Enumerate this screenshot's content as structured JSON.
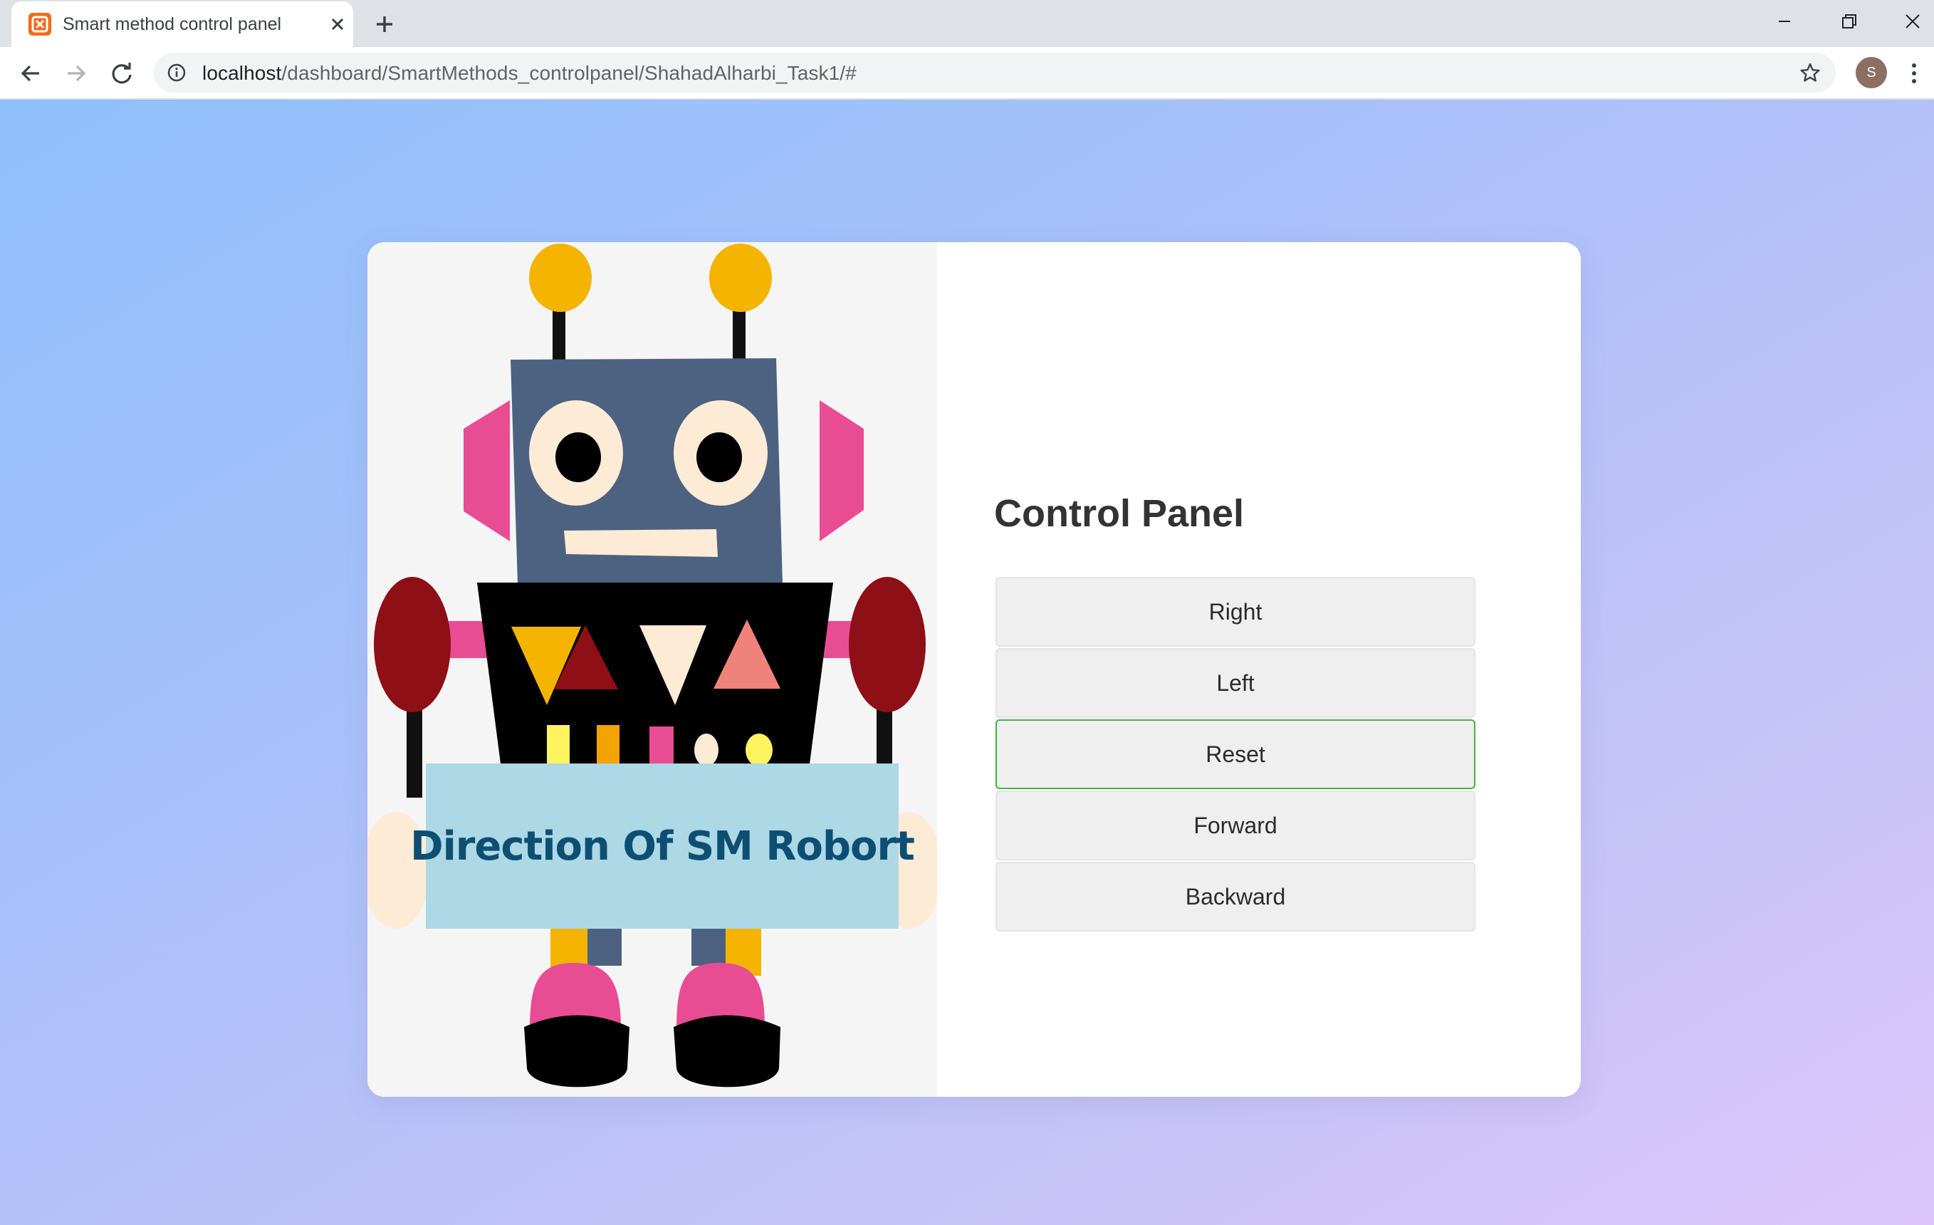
{
  "browser": {
    "tab_title": "Smart method control panel",
    "url_host": "localhost",
    "url_path": "/dashboard/SmartMethods_controlpanel/ShahadAlharbi_Task1/#",
    "profile_initial": "S"
  },
  "robot": {
    "sign_text": "Direction Of SM Robort"
  },
  "control_panel": {
    "title": "Control Panel",
    "buttons": [
      {
        "label": "Right"
      },
      {
        "label": "Left"
      },
      {
        "label": "Reset",
        "focused": true
      },
      {
        "label": "Forward"
      },
      {
        "label": "Backward"
      }
    ]
  },
  "colors": {
    "focus_border": "#43b243",
    "sign_background": "#add8e6",
    "sign_text": "#0d4f72"
  }
}
